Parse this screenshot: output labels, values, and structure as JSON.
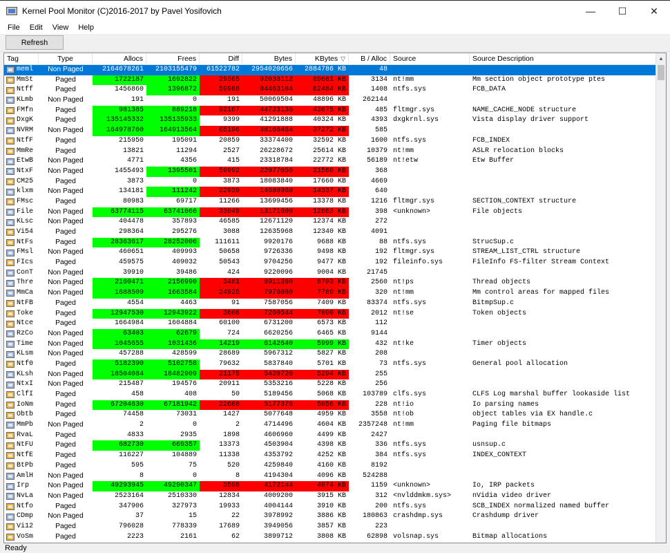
{
  "window": {
    "title": "Kernel Pool Monitor (C)2016-2017 by Pavel Yosifovich",
    "minimize": "—",
    "maximize": "☐",
    "close": "✕"
  },
  "menu": [
    "File",
    "Edit",
    "View",
    "Help"
  ],
  "toolbar": {
    "refresh_label": "Refresh"
  },
  "columns": [
    "Tag",
    "Type",
    "Allocs",
    "Frees",
    "Diff",
    "Bytes",
    "KBytes",
    "B / Alloc",
    "Source",
    "Source Description"
  ],
  "sort": {
    "column": "KBytes",
    "direction": "descending",
    "indicator": "▽"
  },
  "highlight_colors": {
    "green": "#00ff00",
    "red": "#ff0000",
    "selection": "#0078d7"
  },
  "rows": [
    {
      "tag": "meml",
      "type": "Non Paged",
      "allocs": "2164678261",
      "frees": "2103155479",
      "diff": "61522782",
      "bytes": "2954020656",
      "kbytes": "2884786 KB",
      "bpa": "48",
      "source": "",
      "desc": "",
      "hl": [
        "",
        "",
        "",
        "",
        ""
      ],
      "sel": true
    },
    {
      "tag": "MmSt",
      "type": "Paged",
      "allocs": "1722187",
      "frees": "1692822",
      "diff": "29365",
      "bytes": "92038112",
      "kbytes": "89881 KB",
      "bpa": "3134",
      "source": "nt!mm",
      "desc": "Mm section object prototype ptes",
      "hl": [
        "g",
        "g",
        "r",
        "r",
        "r"
      ]
    },
    {
      "tag": "Ntff",
      "type": "Paged",
      "allocs": "1456860",
      "frees": "1396872",
      "diff": "59988",
      "bytes": "84463104",
      "kbytes": "82484 KB",
      "bpa": "1408",
      "source": "ntfs.sys",
      "desc": "FCB_DATA",
      "hl": [
        "",
        "g",
        "r",
        "r",
        "r"
      ]
    },
    {
      "tag": "KLmb",
      "type": "Non Paged",
      "allocs": "191",
      "frees": "0",
      "diff": "191",
      "bytes": "50069504",
      "kbytes": "48896 KB",
      "bpa": "262144",
      "source": "",
      "desc": "",
      "hl": [
        "",
        "",
        "",
        "",
        ""
      ]
    },
    {
      "tag": "FMfn",
      "type": "Paged",
      "allocs": "981385",
      "frees": "889218",
      "diff": "92167",
      "bytes": "44723136",
      "kbytes": "43675 KB",
      "bpa": "485",
      "source": "fltmgr.sys",
      "desc": "NAME_CACHE_NODE structure",
      "hl": [
        "g",
        "g",
        "r",
        "r",
        "r"
      ]
    },
    {
      "tag": "DxgK",
      "type": "Paged",
      "allocs": "135145332",
      "frees": "135135933",
      "diff": "9399",
      "bytes": "41291888",
      "kbytes": "40324 KB",
      "bpa": "4393",
      "source": "dxgkrnl.sys",
      "desc": "Vista display driver support",
      "hl": [
        "g",
        "g",
        "",
        "",
        ""
      ]
    },
    {
      "tag": "NVRM",
      "type": "Non Paged",
      "allocs": "164978760",
      "frees": "164913564",
      "diff": "65196",
      "bytes": "38166464",
      "kbytes": "37272 KB",
      "bpa": "585",
      "source": "",
      "desc": "",
      "hl": [
        "g",
        "g",
        "r",
        "r",
        "r"
      ]
    },
    {
      "tag": "NtfF",
      "type": "Paged",
      "allocs": "215950",
      "frees": "195091",
      "diff": "20859",
      "bytes": "33374400",
      "kbytes": "32592 KB",
      "bpa": "1600",
      "source": "ntfs.sys",
      "desc": "FCB_INDEX",
      "hl": [
        "",
        "",
        "",
        "",
        ""
      ]
    },
    {
      "tag": "MmRe",
      "type": "Paged",
      "allocs": "13821",
      "frees": "11294",
      "diff": "2527",
      "bytes": "26228672",
      "kbytes": "25614 KB",
      "bpa": "10379",
      "source": "nt!mm",
      "desc": "ASLR relocation blocks",
      "hl": [
        "",
        "",
        "",
        "",
        ""
      ]
    },
    {
      "tag": "EtwB",
      "type": "Non Paged",
      "allocs": "4771",
      "frees": "4356",
      "diff": "415",
      "bytes": "23318784",
      "kbytes": "22772 KB",
      "bpa": "56189",
      "source": "nt!etw",
      "desc": "Etw Buffer",
      "hl": [
        "",
        "",
        "",
        "",
        ""
      ]
    },
    {
      "tag": "NtxF",
      "type": "Non Paged",
      "allocs": "1455493",
      "frees": "1395501",
      "diff": "59992",
      "bytes": "22077056",
      "kbytes": "21560 KB",
      "bpa": "368",
      "source": "",
      "desc": "",
      "hl": [
        "",
        "g",
        "r",
        "r",
        "r"
      ]
    },
    {
      "tag": "CM25",
      "type": "Paged",
      "allocs": "3873",
      "frees": "0",
      "diff": "3873",
      "bytes": "18083840",
      "kbytes": "17660 KB",
      "bpa": "4669",
      "source": "",
      "desc": "",
      "hl": [
        "",
        "",
        "",
        "",
        ""
      ]
    },
    {
      "tag": "klxm",
      "type": "Non Paged",
      "allocs": "134181",
      "frees": "111242",
      "diff": "22939",
      "bytes": "14680960",
      "kbytes": "14337 KB",
      "bpa": "640",
      "source": "",
      "desc": "",
      "hl": [
        "",
        "g",
        "r",
        "r",
        "r"
      ]
    },
    {
      "tag": "FMsc",
      "type": "Paged",
      "allocs": "80983",
      "frees": "69717",
      "diff": "11266",
      "bytes": "13699456",
      "kbytes": "13378 KB",
      "bpa": "1216",
      "source": "fltmgr.sys",
      "desc": "SECTION_CONTEXT structure",
      "hl": [
        "",
        "",
        "",
        "",
        ""
      ]
    },
    {
      "tag": "File",
      "type": "Non Paged",
      "allocs": "63774115",
      "frees": "63741066",
      "diff": "33049",
      "bytes": "13171600",
      "kbytes": "12863 KB",
      "bpa": "398",
      "source": "<unknown>",
      "desc": "File objects",
      "hl": [
        "g",
        "g",
        "r",
        "r",
        "r"
      ]
    },
    {
      "tag": "KLsc",
      "type": "Non Paged",
      "allocs": "404478",
      "frees": "357893",
      "diff": "46585",
      "bytes": "12671120",
      "kbytes": "12374 KB",
      "bpa": "272",
      "source": "",
      "desc": "",
      "hl": [
        "",
        "",
        "",
        "",
        ""
      ]
    },
    {
      "tag": "Vi54",
      "type": "Paged",
      "allocs": "298364",
      "frees": "295276",
      "diff": "3088",
      "bytes": "12635968",
      "kbytes": "12340 KB",
      "bpa": "4091",
      "source": "",
      "desc": "",
      "hl": [
        "",
        "",
        "",
        "",
        ""
      ]
    },
    {
      "tag": "NtFs",
      "type": "Paged",
      "allocs": "28363617",
      "frees": "28252006",
      "diff": "111611",
      "bytes": "9920176",
      "kbytes": "9688 KB",
      "bpa": "88",
      "source": "ntfs.sys",
      "desc": "StrucSup.c",
      "hl": [
        "g",
        "g",
        "",
        "",
        ""
      ]
    },
    {
      "tag": "FMsl",
      "type": "Non Paged",
      "allocs": "460651",
      "frees": "409993",
      "diff": "50658",
      "bytes": "9726336",
      "kbytes": "9498 KB",
      "bpa": "192",
      "source": "fltmgr.sys",
      "desc": "STREAM_LIST_CTRL structure",
      "hl": [
        "",
        "",
        "",
        "",
        ""
      ]
    },
    {
      "tag": "FIcs",
      "type": "Paged",
      "allocs": "459575",
      "frees": "409032",
      "diff": "50543",
      "bytes": "9704256",
      "kbytes": "9477 KB",
      "bpa": "192",
      "source": "fileinfo.sys",
      "desc": "FileInfo FS-filter Stream Context",
      "hl": [
        "",
        "",
        "",
        "",
        ""
      ]
    },
    {
      "tag": "ConT",
      "type": "Non Paged",
      "allocs": "39910",
      "frees": "39486",
      "diff": "424",
      "bytes": "9220096",
      "kbytes": "9004 KB",
      "bpa": "21745",
      "source": "",
      "desc": "",
      "hl": [
        "",
        "",
        "",
        "",
        ""
      ]
    },
    {
      "tag": "Thre",
      "type": "Non Paged",
      "allocs": "2160471",
      "frees": "2156990",
      "diff": "3481",
      "bytes": "8911360",
      "kbytes": "8703 KB",
      "bpa": "2560",
      "source": "nt!ps",
      "desc": "Thread objects",
      "hl": [
        "g",
        "g",
        "r",
        "r",
        "r"
      ]
    },
    {
      "tag": "MmCa",
      "type": "Non Paged",
      "allocs": "1688509",
      "frees": "1663584",
      "diff": "24925",
      "bytes": "7976080",
      "kbytes": "7789 KB",
      "bpa": "320",
      "source": "nt!mm",
      "desc": "Mm control areas for mapped files",
      "hl": [
        "g",
        "g",
        "r",
        "r",
        "r"
      ]
    },
    {
      "tag": "NtFB",
      "type": "Paged",
      "allocs": "4554",
      "frees": "4463",
      "diff": "91",
      "bytes": "7587056",
      "kbytes": "7409 KB",
      "bpa": "83374",
      "source": "ntfs.sys",
      "desc": "BitmpSup.c",
      "hl": [
        "",
        "",
        "",
        "",
        ""
      ]
    },
    {
      "tag": "Toke",
      "type": "Paged",
      "allocs": "12947530",
      "frees": "12943922",
      "diff": "3608",
      "bytes": "7260544",
      "kbytes": "7090 KB",
      "bpa": "2012",
      "source": "nt!se",
      "desc": "Token objects",
      "hl": [
        "g",
        "g",
        "r",
        "r",
        "r"
      ]
    },
    {
      "tag": "Ntce",
      "type": "Paged",
      "allocs": "1664984",
      "frees": "1604884",
      "diff": "60100",
      "bytes": "6731200",
      "kbytes": "6573 KB",
      "bpa": "112",
      "source": "",
      "desc": "",
      "hl": [
        "",
        "",
        "",
        "",
        ""
      ]
    },
    {
      "tag": "RzCo",
      "type": "Non Paged",
      "allocs": "63403",
      "frees": "62679",
      "diff": "724",
      "bytes": "6620256",
      "kbytes": "6465 KB",
      "bpa": "9144",
      "source": "",
      "desc": "",
      "hl": [
        "g",
        "g",
        "",
        "",
        ""
      ]
    },
    {
      "tag": "Time",
      "type": "Non Paged",
      "allocs": "1045655",
      "frees": "1031436",
      "diff": "14219",
      "bytes": "6142640",
      "kbytes": "5999 KB",
      "bpa": "432",
      "source": "nt!ke",
      "desc": "Timer objects",
      "hl": [
        "g",
        "g",
        "g",
        "g",
        "g"
      ]
    },
    {
      "tag": "KLsm",
      "type": "Non Paged",
      "allocs": "457288",
      "frees": "428599",
      "diff": "28689",
      "bytes": "5967312",
      "kbytes": "5827 KB",
      "bpa": "208",
      "source": "",
      "desc": "",
      "hl": [
        "",
        "",
        "",
        "",
        ""
      ]
    },
    {
      "tag": "Ntf0",
      "type": "Paged",
      "allocs": "5182390",
      "frees": "5102758",
      "diff": "79632",
      "bytes": "5837840",
      "kbytes": "5701 KB",
      "bpa": "73",
      "source": "ntfs.sys",
      "desc": "General pool allocation",
      "hl": [
        "g",
        "g",
        "",
        "",
        ""
      ]
    },
    {
      "tag": "KLsh",
      "type": "Non Paged",
      "allocs": "18504084",
      "frees": "18482909",
      "diff": "21175",
      "bytes": "5420720",
      "kbytes": "5294 KB",
      "bpa": "255",
      "source": "",
      "desc": "",
      "hl": [
        "g",
        "g",
        "r",
        "r",
        "r"
      ]
    },
    {
      "tag": "NtxI",
      "type": "Non Paged",
      "allocs": "215487",
      "frees": "194576",
      "diff": "20911",
      "bytes": "5353216",
      "kbytes": "5228 KB",
      "bpa": "256",
      "source": "",
      "desc": "",
      "hl": [
        "",
        "",
        "",
        "",
        ""
      ]
    },
    {
      "tag": "ClfI",
      "type": "Paged",
      "allocs": "458",
      "frees": "408",
      "diff": "50",
      "bytes": "5189456",
      "kbytes": "5068 KB",
      "bpa": "103789",
      "source": "clfs.sys",
      "desc": "CLFS Log marshal buffer lookaside list",
      "hl": [
        "",
        "",
        "",
        "",
        ""
      ]
    },
    {
      "tag": "IoNm",
      "type": "Paged",
      "allocs": "67204630",
      "frees": "67181942",
      "diff": "22688",
      "bytes": "5177376",
      "kbytes": "5056 KB",
      "bpa": "228",
      "source": "nt!io",
      "desc": "Io parsing names",
      "hl": [
        "g",
        "g",
        "r",
        "r",
        "r"
      ]
    },
    {
      "tag": "Obtb",
      "type": "Paged",
      "allocs": "74458",
      "frees": "73031",
      "diff": "1427",
      "bytes": "5077648",
      "kbytes": "4959 KB",
      "bpa": "3558",
      "source": "nt!ob",
      "desc": "object tables via EX handle.c",
      "hl": [
        "",
        "",
        "",
        "",
        ""
      ]
    },
    {
      "tag": "MmPb",
      "type": "Non Paged",
      "allocs": "2",
      "frees": "0",
      "diff": "2",
      "bytes": "4714496",
      "kbytes": "4604 KB",
      "bpa": "2357248",
      "source": "nt!mm",
      "desc": "Paging file bitmaps",
      "hl": [
        "",
        "",
        "",
        "",
        ""
      ]
    },
    {
      "tag": "RvaL",
      "type": "Paged",
      "allocs": "4833",
      "frees": "2935",
      "diff": "1898",
      "bytes": "4606960",
      "kbytes": "4499 KB",
      "bpa": "2427",
      "source": "",
      "desc": "",
      "hl": [
        "",
        "",
        "",
        "",
        ""
      ]
    },
    {
      "tag": "NtFU",
      "type": "Paged",
      "allocs": "682730",
      "frees": "669357",
      "diff": "13373",
      "bytes": "4503904",
      "kbytes": "4398 KB",
      "bpa": "336",
      "source": "ntfs.sys",
      "desc": "usnsup.c",
      "hl": [
        "g",
        "g",
        "",
        "",
        ""
      ]
    },
    {
      "tag": "NtfE",
      "type": "Paged",
      "allocs": "116227",
      "frees": "104889",
      "diff": "11338",
      "bytes": "4353792",
      "kbytes": "4252 KB",
      "bpa": "384",
      "source": "ntfs.sys",
      "desc": "INDEX_CONTEXT",
      "hl": [
        "",
        "",
        "",
        "",
        ""
      ]
    },
    {
      "tag": "BtPb",
      "type": "Paged",
      "allocs": "595",
      "frees": "75",
      "diff": "520",
      "bytes": "4259840",
      "kbytes": "4160 KB",
      "bpa": "8192",
      "source": "",
      "desc": "",
      "hl": [
        "",
        "",
        "",
        "",
        ""
      ]
    },
    {
      "tag": "AmlH",
      "type": "Non Paged",
      "allocs": "8",
      "frees": "0",
      "diff": "8",
      "bytes": "4194304",
      "kbytes": "4096 KB",
      "bpa": "524288",
      "source": "",
      "desc": "",
      "hl": [
        "",
        "",
        "",
        "",
        ""
      ]
    },
    {
      "tag": "Irp",
      "type": "Non Paged",
      "allocs": "49293945",
      "frees": "49290347",
      "diff": "3598",
      "bytes": "4172144",
      "kbytes": "4074 KB",
      "bpa": "1159",
      "source": "<unknown>",
      "desc": "Io, IRP packets",
      "hl": [
        "g",
        "g",
        "r",
        "r",
        "r"
      ]
    },
    {
      "tag": "NvLa",
      "type": "Non Paged",
      "allocs": "2523164",
      "frees": "2510330",
      "diff": "12834",
      "bytes": "4009200",
      "kbytes": "3915 KB",
      "bpa": "312",
      "source": "<nvlddmkm.sys>",
      "desc": "nVidia video driver",
      "hl": [
        "",
        "",
        "",
        "",
        ""
      ]
    },
    {
      "tag": "Ntfo",
      "type": "Paged",
      "allocs": "347906",
      "frees": "327973",
      "diff": "19933",
      "bytes": "4004144",
      "kbytes": "3910 KB",
      "bpa": "200",
      "source": "ntfs.sys",
      "desc": "SCB_INDEX normalized named buffer",
      "hl": [
        "",
        "",
        "",
        "",
        ""
      ]
    },
    {
      "tag": "CDmp",
      "type": "Non Paged",
      "allocs": "37",
      "frees": "15",
      "diff": "22",
      "bytes": "3978992",
      "kbytes": "3886 KB",
      "bpa": "180863",
      "source": "crashdmp.sys",
      "desc": "Crashdump driver",
      "hl": [
        "",
        "",
        "",
        "",
        ""
      ]
    },
    {
      "tag": "Vi12",
      "type": "Paged",
      "allocs": "796028",
      "frees": "778339",
      "diff": "17689",
      "bytes": "3949056",
      "kbytes": "3857 KB",
      "bpa": "223",
      "source": "",
      "desc": "",
      "hl": [
        "",
        "",
        "",
        "",
        ""
      ]
    },
    {
      "tag": "VoSm",
      "type": "Paged",
      "allocs": "2223",
      "frees": "2161",
      "diff": "62",
      "bytes": "3899712",
      "kbytes": "3808 KB",
      "bpa": "62898",
      "source": "volsnap.sys",
      "desc": "Bitmap allocations",
      "hl": [
        "",
        "",
        "",
        "",
        ""
      ]
    }
  ],
  "status": "Ready"
}
